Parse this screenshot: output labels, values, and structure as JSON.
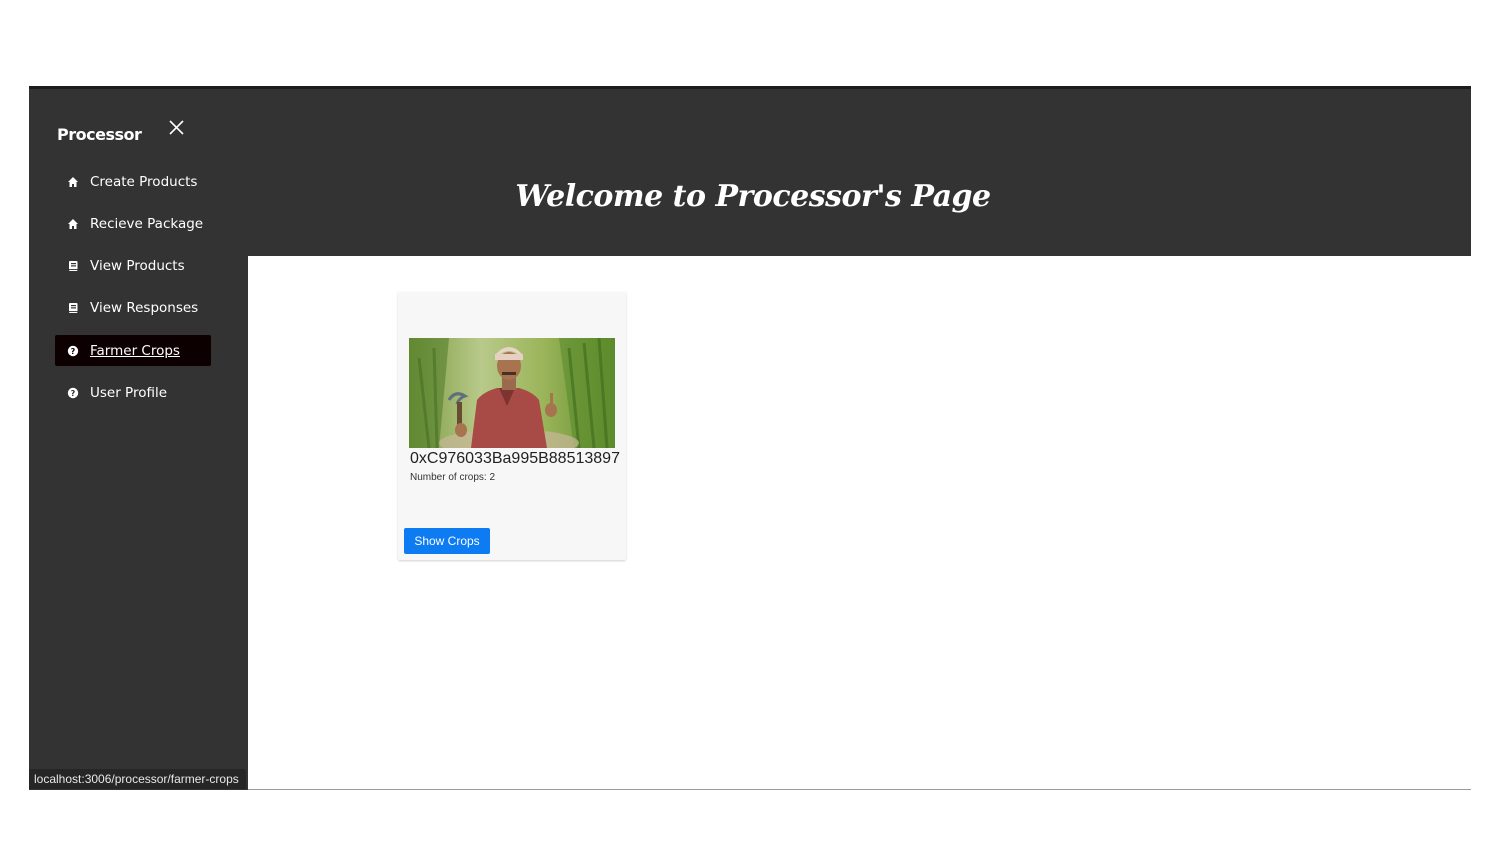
{
  "sidebar": {
    "brand": "Processor",
    "close_icon": "close-icon",
    "items": [
      {
        "label": "Create Products",
        "icon": "home-icon",
        "active": false
      },
      {
        "label": "Recieve Package",
        "icon": "home-icon",
        "active": false
      },
      {
        "label": "View Products",
        "icon": "book-icon",
        "active": false
      },
      {
        "label": "View Responses",
        "icon": "book-icon",
        "active": false
      },
      {
        "label": "Farmer Crops",
        "icon": "help-circle-icon",
        "active": true
      },
      {
        "label": "User Profile",
        "icon": "help-circle-icon",
        "active": false
      }
    ]
  },
  "header": {
    "title": "Welcome to Processor's Page"
  },
  "farmer_card": {
    "image_icon": "farmer-photo",
    "address": "0xC976033Ba995B88513897",
    "crops_count": "Number of crops: 2",
    "button_label": "Show Crops"
  },
  "status_bar": {
    "url": "localhost:3006/processor/farmer-crops"
  },
  "colors": {
    "sidebar_bg": "#333333",
    "header_bg": "#333333",
    "active_item_bg": "#0d0000",
    "button_bg": "#0d7bf2",
    "card_bg": "#f7f7f7"
  }
}
